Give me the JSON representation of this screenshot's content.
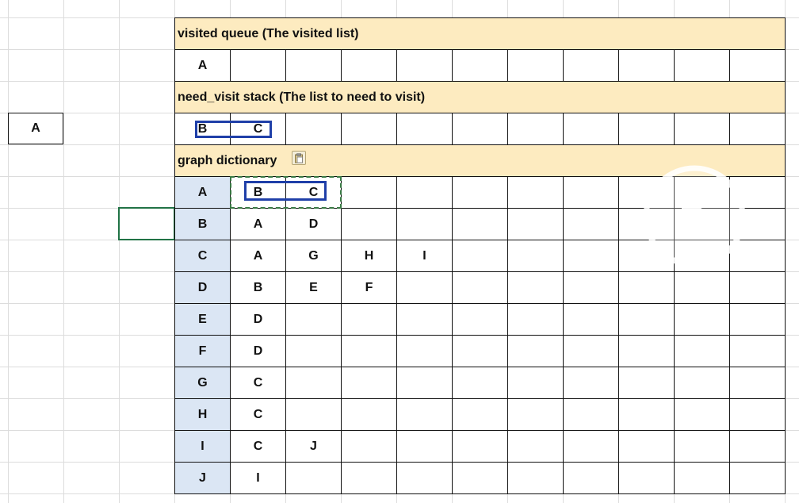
{
  "side_cell": "A",
  "sections": {
    "visited": {
      "title": "visited queue (The visited list)",
      "values": [
        "A",
        "",
        "",
        "",
        "",
        "",
        "",
        "",
        "",
        "",
        ""
      ]
    },
    "need_visit": {
      "title": "need_visit stack (The list to need to visit)",
      "values": [
        "B",
        "C",
        "",
        "",
        "",
        "",
        "",
        "",
        "",
        "",
        ""
      ]
    },
    "graph": {
      "title": "graph dictionary",
      "rows": [
        {
          "key": "A",
          "values": [
            "B",
            "C",
            "",
            "",
            "",
            "",
            "",
            "",
            "",
            ""
          ]
        },
        {
          "key": "B",
          "values": [
            "A",
            "D",
            "",
            "",
            "",
            "",
            "",
            "",
            "",
            ""
          ]
        },
        {
          "key": "C",
          "values": [
            "A",
            "G",
            "H",
            "I",
            "",
            "",
            "",
            "",
            "",
            ""
          ]
        },
        {
          "key": "D",
          "values": [
            "B",
            "E",
            "F",
            "",
            "",
            "",
            "",
            "",
            "",
            ""
          ]
        },
        {
          "key": "E",
          "values": [
            "D",
            "",
            "",
            "",
            "",
            "",
            "",
            "",
            "",
            ""
          ]
        },
        {
          "key": "F",
          "values": [
            "D",
            "",
            "",
            "",
            "",
            "",
            "",
            "",
            "",
            ""
          ]
        },
        {
          "key": "G",
          "values": [
            "C",
            "",
            "",
            "",
            "",
            "",
            "",
            "",
            "",
            ""
          ]
        },
        {
          "key": "H",
          "values": [
            "C",
            "",
            "",
            "",
            "",
            "",
            "",
            "",
            "",
            ""
          ]
        },
        {
          "key": "I",
          "values": [
            "C",
            "J",
            "",
            "",
            "",
            "",
            "",
            "",
            "",
            ""
          ]
        },
        {
          "key": "J",
          "values": [
            "I",
            "",
            "",
            "",
            "",
            "",
            "",
            "",
            "",
            ""
          ]
        }
      ]
    }
  },
  "icons": {
    "paste": "paste-options-icon",
    "play": "play-icon"
  },
  "colors": {
    "header_fill": "#fdebc0",
    "key_fill": "#dbe6f4",
    "highlight_box": "#1f3fa8",
    "copy_marquee": "#3a7a45",
    "active_cell_border": "#217346"
  }
}
